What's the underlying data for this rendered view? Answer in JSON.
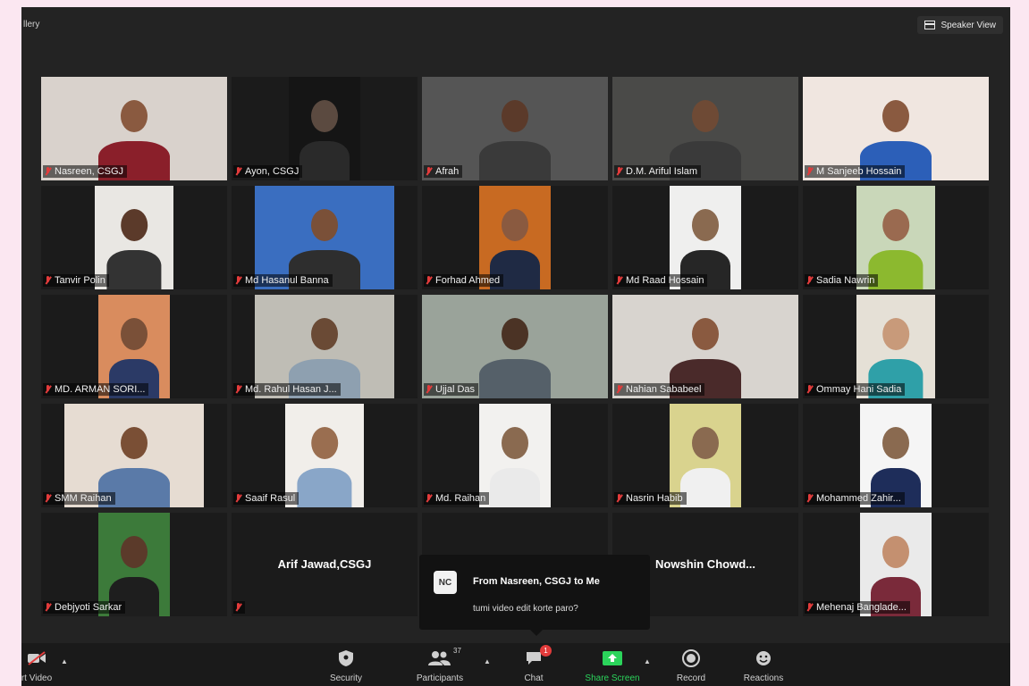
{
  "window": {
    "top_left_label": "llery",
    "speaker_view_label": "Speaker View"
  },
  "participants": [
    {
      "name": "Nasreen, CSGJ",
      "bg": "#d9d2cc",
      "skin": "#8a5a40",
      "shirt": "#8a1f2a",
      "video_w": 208,
      "active": false
    },
    {
      "name": "Ayon, CSGJ",
      "bg": "#151515",
      "skin": "#5b4a40",
      "shirt": "#2a2a2a",
      "video_w": 80,
      "active": false
    },
    {
      "name": "Afrah",
      "bg": "#555555",
      "skin": "#5b3a2a",
      "shirt": "#3a3a3a",
      "video_w": 208,
      "active": false
    },
    {
      "name": "D.M. Ariful Islam",
      "bg": "#4a4a48",
      "skin": "#6e4a35",
      "shirt": "#3a3a3a",
      "video_w": 208,
      "active": true
    },
    {
      "name": "M Sanjeeb Hossain",
      "bg": "#f0e6e0",
      "skin": "#8a5a40",
      "shirt": "#2c5fb8",
      "video_w": 208,
      "active": false
    },
    {
      "name": "Tanvir Polin",
      "bg": "#e9e7e3",
      "skin": "#5b3a2a",
      "shirt": "#333333",
      "video_w": 88,
      "active": false
    },
    {
      "name": "Md Hasanul Banna",
      "bg": "#3a6ec0",
      "skin": "#7a5038",
      "shirt": "#2e2e2e",
      "video_w": 156,
      "active": false
    },
    {
      "name": "Forhad Ahmed",
      "bg": "#c86a22",
      "skin": "#8a5a40",
      "shirt": "#1f2a44",
      "video_w": 80,
      "active": false
    },
    {
      "name": "Md Raad Hossain",
      "bg": "#efefee",
      "skin": "#8a6a50",
      "shirt": "#262626",
      "video_w": 80,
      "active": false
    },
    {
      "name": "Sadia Nawrin",
      "bg": "#c9d7b9",
      "skin": "#9a6a50",
      "shirt": "#8cb92f",
      "video_w": 88,
      "active": false
    },
    {
      "name": "MD. ARMAN SORI...",
      "bg": "#d98c5e",
      "skin": "#7a5038",
      "shirt": "#2b3a66",
      "video_w": 80,
      "active": false
    },
    {
      "name": "Md. Rahul Hasan J...",
      "bg": "#bfbdb5",
      "skin": "#6a4a35",
      "shirt": "#8ea0b0",
      "video_w": 156,
      "active": false
    },
    {
      "name": "Ujjal Das",
      "bg": "#9aa39a",
      "skin": "#4b3325",
      "shirt": "#556069",
      "video_w": 208,
      "active": false
    },
    {
      "name": "Nahian Sababeel",
      "bg": "#d8d4cf",
      "skin": "#8a5a40",
      "shirt": "#4a2a2a",
      "video_w": 208,
      "active": false
    },
    {
      "name": "Ommay Hani Sadia",
      "bg": "#e5e0d6",
      "skin": "#c89a7a",
      "shirt": "#2fa0a8",
      "video_w": 88,
      "active": false
    },
    {
      "name": "SMM Raihan",
      "bg": "#e6dcd2",
      "skin": "#7a4f35",
      "shirt": "#5a7aa8",
      "video_w": 156,
      "active": false
    },
    {
      "name": "Saaif Rasul",
      "bg": "#f1eeea",
      "skin": "#9a6e50",
      "shirt": "#89a6c8",
      "video_w": 88,
      "active": false
    },
    {
      "name": "Md. Raihan",
      "bg": "#f2f1ef",
      "skin": "#8a6a50",
      "shirt": "#eaeaea",
      "video_w": 80,
      "active": false
    },
    {
      "name": "Nasrin Habib",
      "bg": "#d9d38e",
      "skin": "#8a6a50",
      "shirt": "#f0f0f0",
      "video_w": 80,
      "active": false
    },
    {
      "name": "Mohammed Zahir...",
      "bg": "#f5f5f5",
      "skin": "#8a6a50",
      "shirt": "#1e2d5a",
      "video_w": 80,
      "active": false
    },
    {
      "name": "Debjyoti Sarkar",
      "bg": "#3c7a3a",
      "skin": "#5b3a2a",
      "shirt": "#1e1e1e",
      "video_w": 80,
      "active": false
    },
    {
      "name": "",
      "center_name": "Arif Jawad,CSGJ",
      "video_w": 0,
      "active": false
    },
    {
      "name": "",
      "center_name": "",
      "video_w": 0,
      "active": false
    },
    {
      "name": "",
      "center_name": "Nowshin  Chowd...",
      "video_w": 0,
      "active": false
    },
    {
      "name": "Mehenaj Banglade...",
      "bg": "#eaeaea",
      "skin": "#c49070",
      "shirt": "#7a2a3a",
      "video_w": 80,
      "active": false
    }
  ],
  "chat_popup": {
    "avatar_text": "NC",
    "from": "From Nasreen, CSGJ to Me",
    "message": "tumi video edit korte paro?"
  },
  "toolbar": {
    "video_label": "rt Video",
    "security_label": "Security",
    "participants_label": "Participants",
    "participants_count": "37",
    "chat_label": "Chat",
    "chat_badge": "1",
    "share_label": "Share Screen",
    "record_label": "Record",
    "reactions_label": "Reactions"
  },
  "colors": {
    "window_bg": "#232323",
    "share_green": "#2bd45b",
    "active_border": "#d6e87a",
    "muted_red": "#e23b3b"
  }
}
